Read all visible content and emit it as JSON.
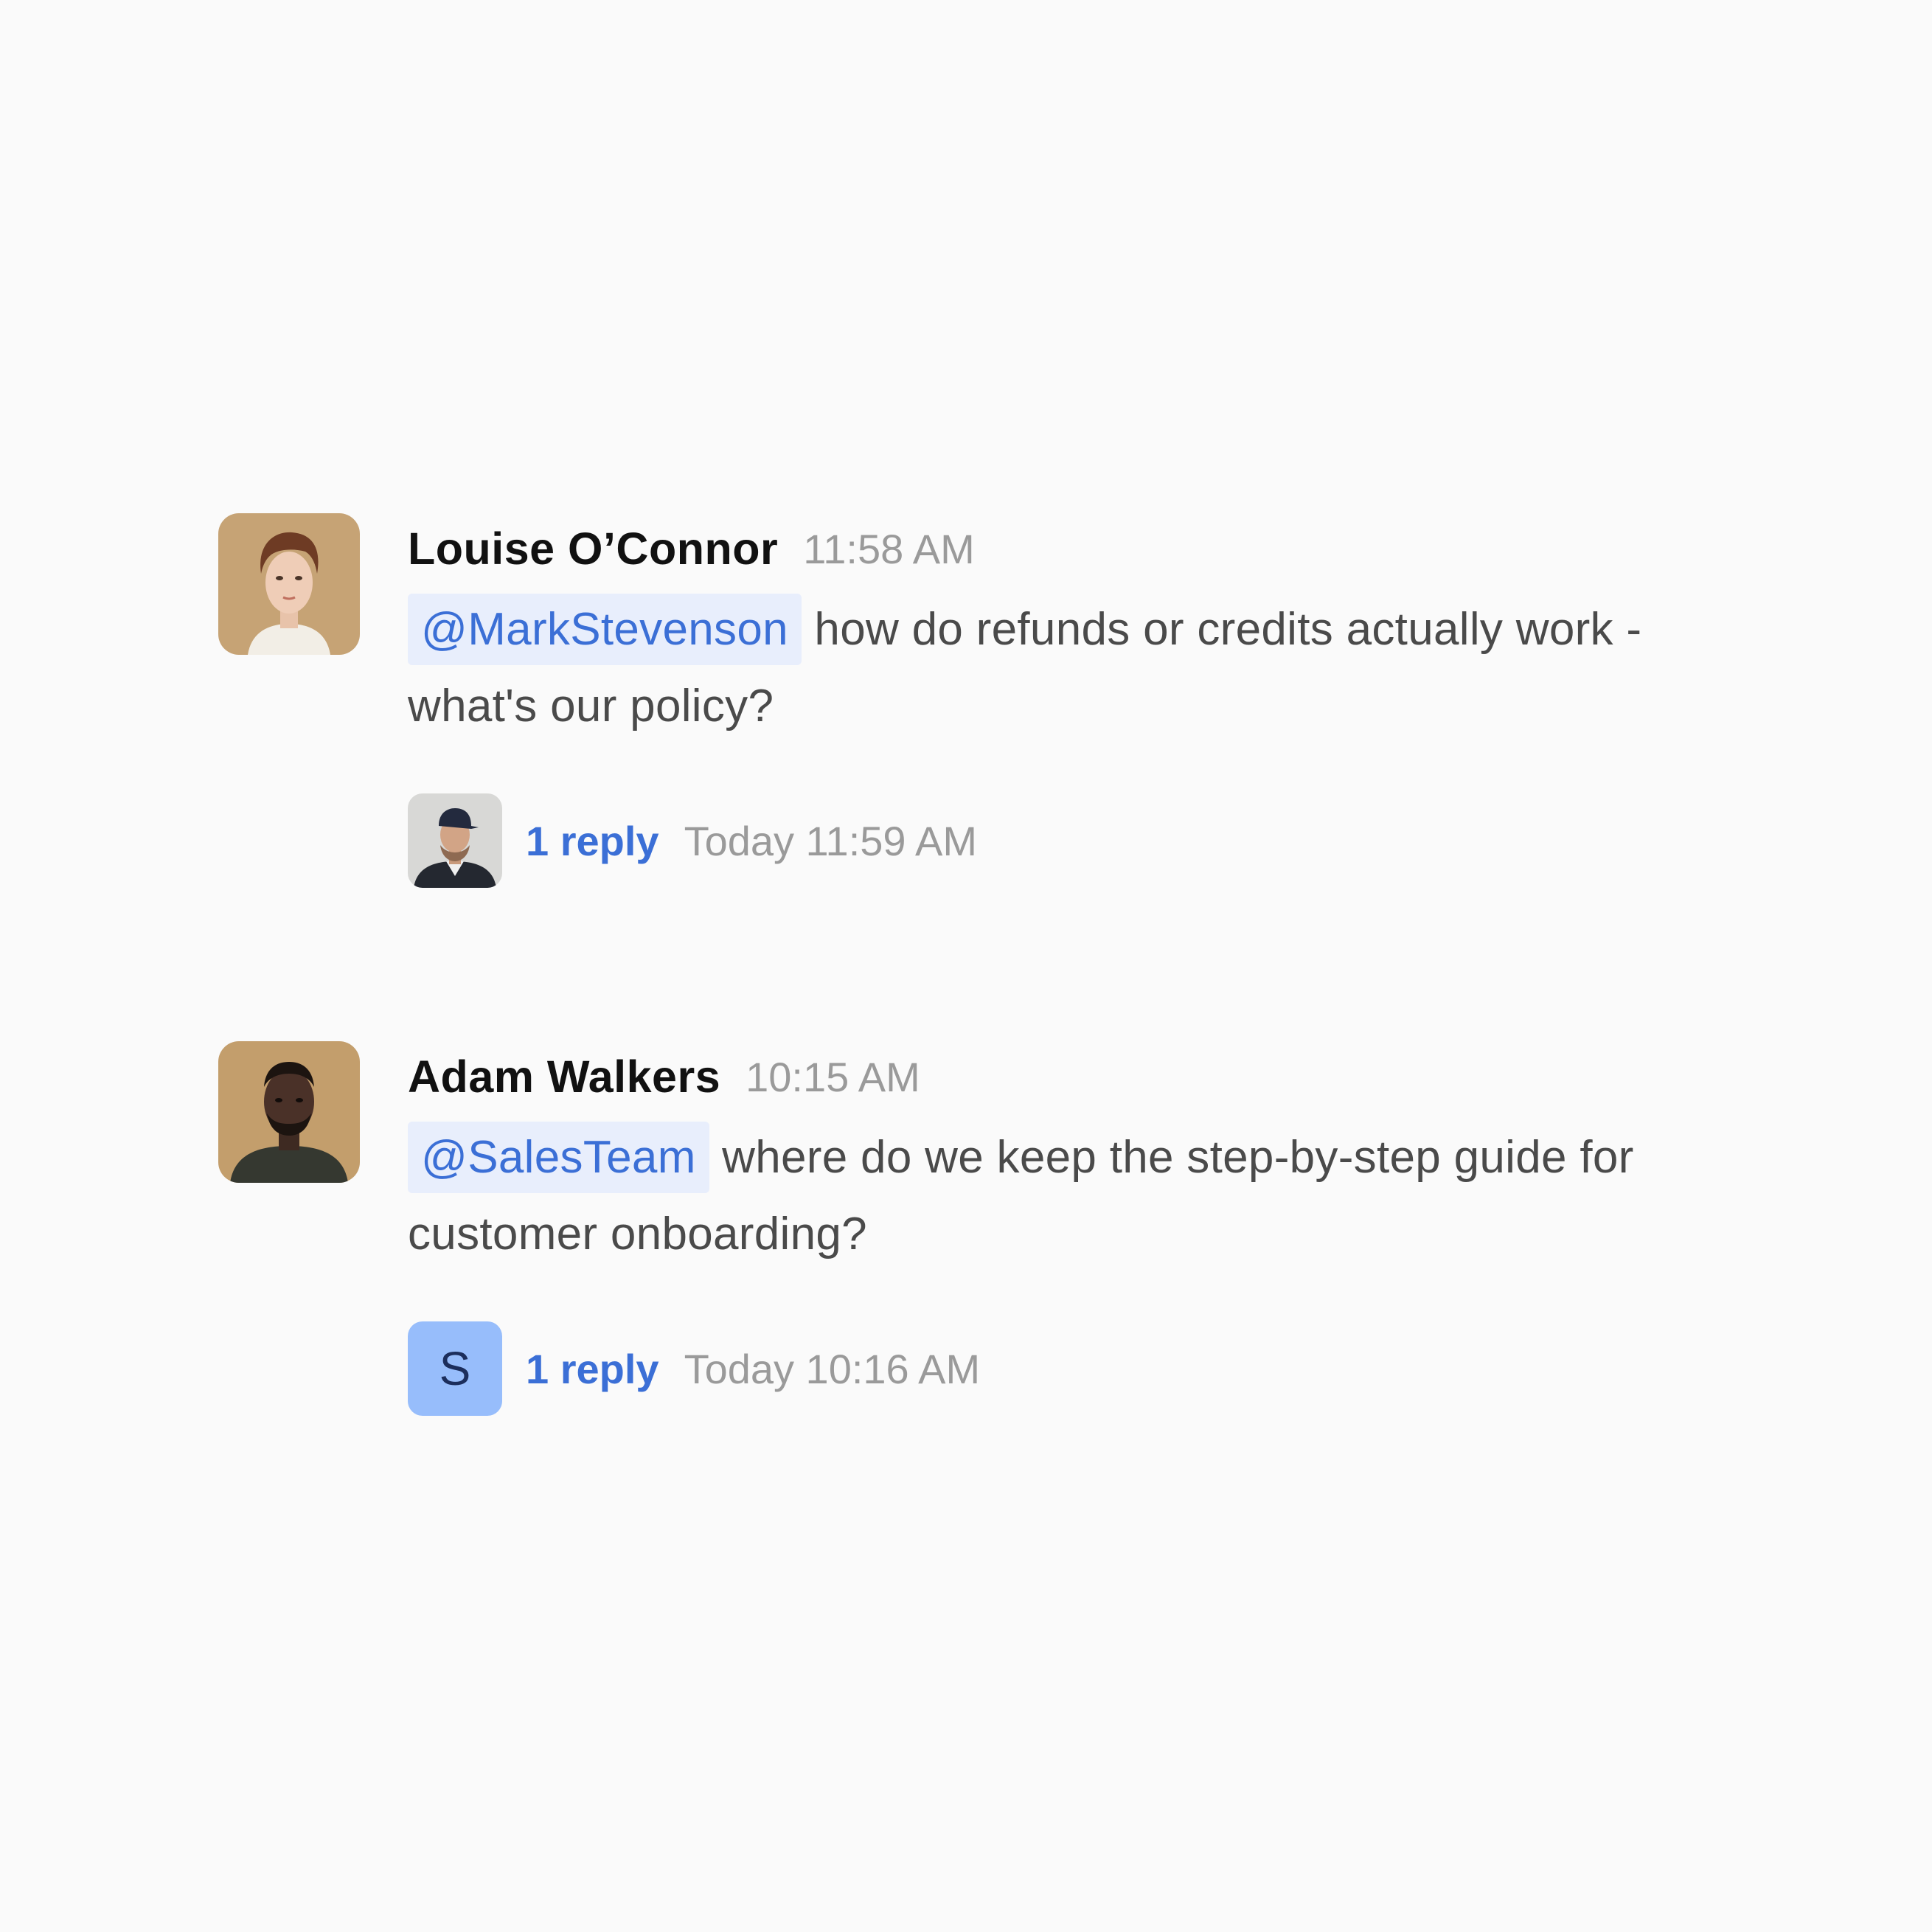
{
  "messages": [
    {
      "author": "Louise O’Connor",
      "time": "11:58 AM",
      "mention": "@MarkStevenson",
      "text": " how do refunds or credits actually work - what's our policy?",
      "thread": {
        "reply_count": "1 reply",
        "last_reply": "Today 11:59 AM"
      }
    },
    {
      "author": "Adam Walkers",
      "time": "10:15 AM",
      "mention": "@SalesTeam",
      "text": " where do we keep the step-by-step guide for customer onboarding?",
      "thread": {
        "reply_count": "1 reply",
        "last_reply": "Today 10:16 AM",
        "avatar_letter": "S"
      }
    }
  ],
  "colors": {
    "background": "#fafafa",
    "mention_bg": "#e8eefc",
    "accent": "#3b6fd6",
    "letter_avatar_bg": "#97bdfb"
  }
}
